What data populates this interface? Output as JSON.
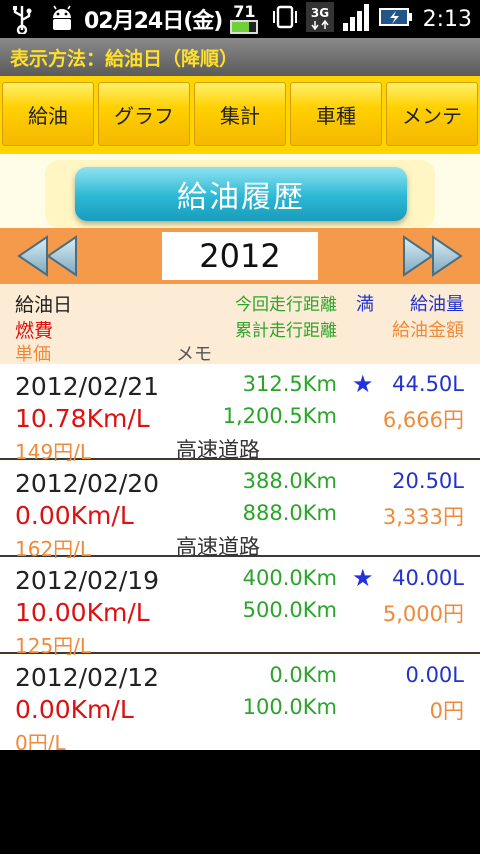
{
  "statusbar": {
    "date": "02月24日(金)",
    "battery_level": "71",
    "network": "3G",
    "time": "2:13"
  },
  "titlebar": {
    "text": "表示方法：給油日（降順）"
  },
  "tabs": [
    {
      "label": "給油"
    },
    {
      "label": "グラフ"
    },
    {
      "label": "集計"
    },
    {
      "label": "車種"
    },
    {
      "label": "メンテ"
    }
  ],
  "banner": {
    "title": "給油履歴"
  },
  "year": {
    "value": "2012"
  },
  "header": {
    "date": "給油日",
    "efficiency": "燃費",
    "unit_price": "単価",
    "memo": "メモ",
    "trip_distance": "今回走行距離",
    "full": "満",
    "fuel_volume": "給油量",
    "total_distance": "累計走行距離",
    "fuel_cost": "給油金額"
  },
  "records": [
    {
      "date": "2012/02/21",
      "efficiency": "10.78Km/L",
      "unit_price": "149円/L",
      "memo": "高速道路",
      "trip_distance": "312.5Km",
      "total_distance": "1,200.5Km",
      "full": "★",
      "volume": "44.50L",
      "cost": "6,666円"
    },
    {
      "date": "2012/02/20",
      "efficiency": "0.00Km/L",
      "unit_price": "162円/L",
      "memo": "高速道路",
      "trip_distance": "388.0Km",
      "total_distance": "888.0Km",
      "full": "",
      "volume": "20.50L",
      "cost": "3,333円"
    },
    {
      "date": "2012/02/19",
      "efficiency": "10.00Km/L",
      "unit_price": "125円/L",
      "memo": "",
      "trip_distance": "400.0Km",
      "total_distance": "500.0Km",
      "full": "★",
      "volume": "40.00L",
      "cost": "5,000円"
    },
    {
      "date": "2012/02/12",
      "efficiency": "0.00Km/L",
      "unit_price": "0円/L",
      "memo": "",
      "trip_distance": "0.0Km",
      "total_distance": "100.0Km",
      "full": "",
      "volume": "0.00L",
      "cost": "0円"
    }
  ],
  "colors": {
    "tab_bar": "#ffd400",
    "title_text": "#ffdf2a",
    "banner": "#2bb8d4",
    "year_bar": "#f59a4a",
    "distance": "#2aa52a",
    "efficiency": "#dd1111",
    "price": "#ef8a3a",
    "volume": "#2233cc"
  }
}
